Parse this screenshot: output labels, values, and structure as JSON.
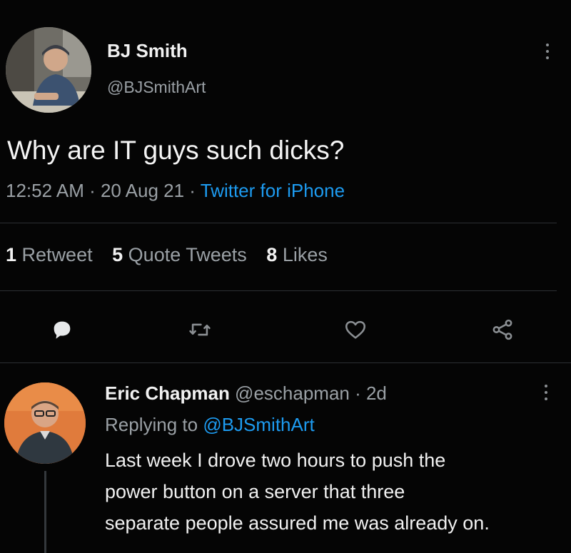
{
  "tweet": {
    "author": {
      "name": "BJ Smith",
      "handle": "@BJSmithArt"
    },
    "text": "Why are IT guys such dicks?",
    "time": "12:52 AM · 20 Aug 21 · ",
    "source": "Twitter for iPhone",
    "stats": [
      {
        "count": "1",
        "label": "Retweet"
      },
      {
        "count": "5",
        "label": "Quote Tweets"
      },
      {
        "count": "8",
        "label": "Likes"
      }
    ],
    "actions": [
      "reply-icon",
      "retweet-icon",
      "like-icon",
      "share-icon"
    ],
    "accent_color": "#1d9bf0"
  },
  "reply": {
    "author": {
      "name": "Eric Chapman",
      "handle_and_age": " @eschapman · 2d"
    },
    "replying_prefix": "Replying to ",
    "replying_to": "@BJSmithArt",
    "text_lines": [
      "Last week I drove two hours to push the",
      "power button on a server that three",
      "separate people assured me was already on."
    ]
  }
}
